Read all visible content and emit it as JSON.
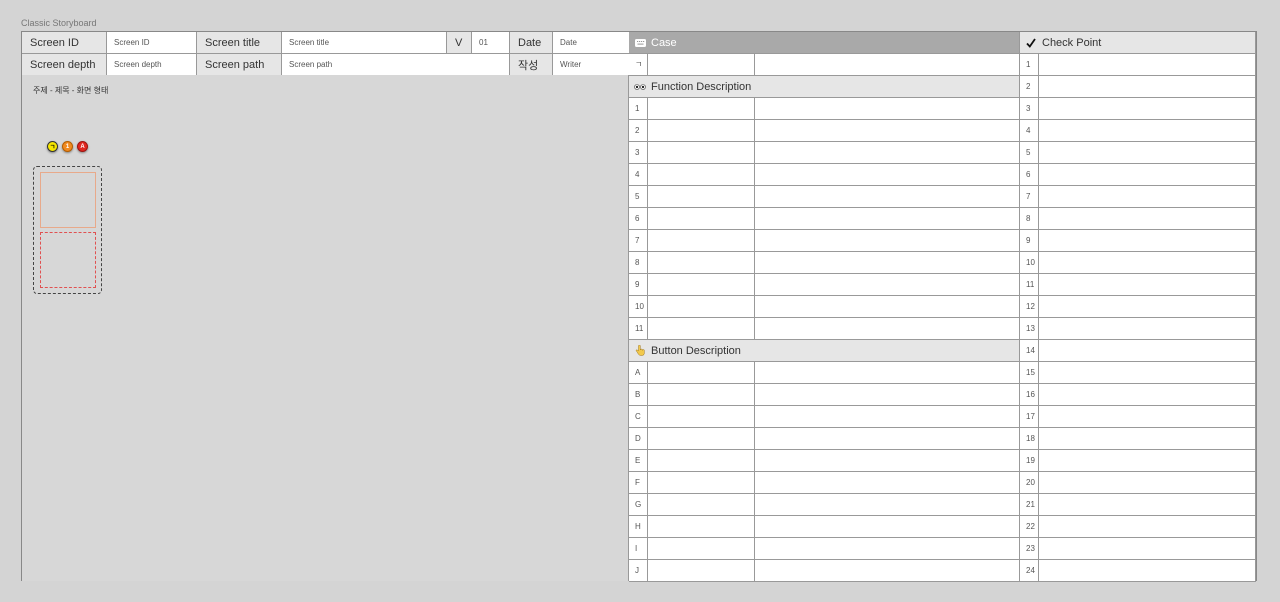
{
  "frame_label": "Classic Storyboard",
  "header": {
    "screen_id_label": "Screen ID",
    "screen_id_value": "Screen ID",
    "screen_title_label": "Screen title",
    "screen_title_value": "Screen title",
    "version_label": "V",
    "version_value": "01",
    "date_label": "Date",
    "date_value": "Date",
    "screen_depth_label": "Screen depth",
    "screen_depth_value": "Screen depth",
    "screen_path_label": "Screen path",
    "screen_path_value": "Screen path",
    "writer_label": "작성",
    "writer_value": "Writer"
  },
  "canvas": {
    "title": "주제 - 제목 - 화면 형태",
    "markers": [
      "ㄱ",
      "1",
      "A"
    ]
  },
  "case": {
    "title": "Case",
    "icon": "keyboard-icon",
    "rows": [
      "ㄱ"
    ]
  },
  "function": {
    "title": "Function Description",
    "icon": "eyes-icon",
    "rows": [
      "1",
      "2",
      "3",
      "4",
      "5",
      "6",
      "7",
      "8",
      "9",
      "10",
      "11"
    ]
  },
  "button": {
    "title": "Button Description",
    "icon": "pointing-hand-icon",
    "rows": [
      "A",
      "B",
      "C",
      "D",
      "E",
      "F",
      "G",
      "H",
      "I",
      "J"
    ]
  },
  "checkpoint": {
    "title": "Check Point",
    "icon": "checkmark-icon",
    "rows": [
      "1",
      "2",
      "3",
      "4",
      "5",
      "6",
      "7",
      "8",
      "9",
      "10",
      "11",
      "12",
      "13",
      "14",
      "15",
      "16",
      "17",
      "18",
      "19",
      "20",
      "21",
      "22",
      "23",
      "24"
    ]
  },
  "colors": {
    "case_header": "#a9a9a9",
    "header_label_bg": "#e6e6e6",
    "canvas_bg": "#d7d7d7"
  }
}
